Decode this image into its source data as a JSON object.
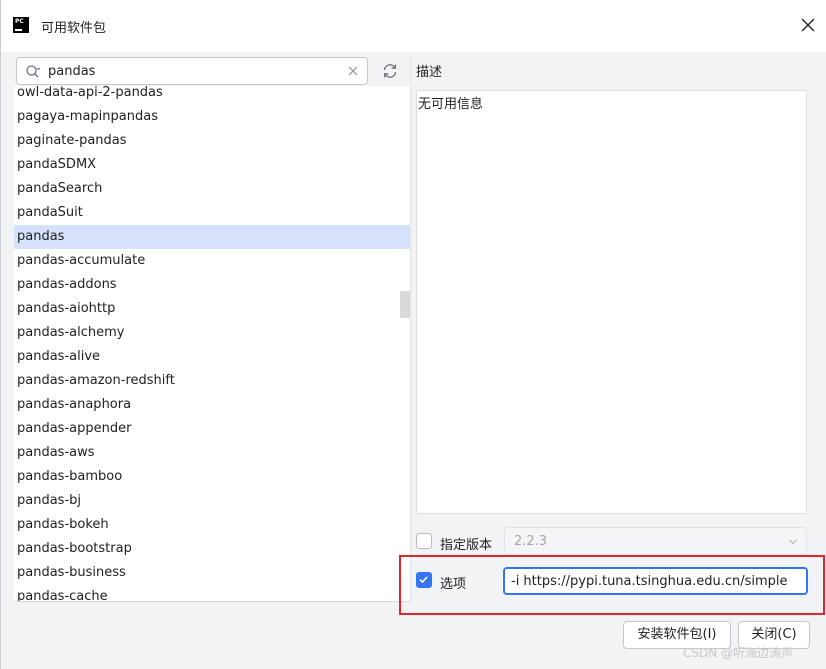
{
  "window": {
    "title": "可用软件包",
    "app_icon_text": "PC"
  },
  "search": {
    "value": "pandas"
  },
  "packages": [
    {
      "name": "owl-data-api-2-pandas",
      "selected": false
    },
    {
      "name": "pagaya-mapinpandas",
      "selected": false
    },
    {
      "name": "paginate-pandas",
      "selected": false
    },
    {
      "name": "pandaSDMX",
      "selected": false
    },
    {
      "name": "pandaSearch",
      "selected": false
    },
    {
      "name": "pandaSuit",
      "selected": false
    },
    {
      "name": "pandas",
      "selected": true
    },
    {
      "name": "pandas-accumulate",
      "selected": false
    },
    {
      "name": "pandas-addons",
      "selected": false
    },
    {
      "name": "pandas-aiohttp",
      "selected": false
    },
    {
      "name": "pandas-alchemy",
      "selected": false
    },
    {
      "name": "pandas-alive",
      "selected": false
    },
    {
      "name": "pandas-amazon-redshift",
      "selected": false
    },
    {
      "name": "pandas-anaphora",
      "selected": false
    },
    {
      "name": "pandas-appender",
      "selected": false
    },
    {
      "name": "pandas-aws",
      "selected": false
    },
    {
      "name": "pandas-bamboo",
      "selected": false
    },
    {
      "name": "pandas-bj",
      "selected": false
    },
    {
      "name": "pandas-bokeh",
      "selected": false
    },
    {
      "name": "pandas-bootstrap",
      "selected": false
    },
    {
      "name": "pandas-business",
      "selected": false
    },
    {
      "name": "pandas-cache",
      "selected": false
    }
  ],
  "description": {
    "label": "描述",
    "text": "无可用信息"
  },
  "version": {
    "checked": false,
    "label": "指定版本",
    "value": "2.2.3"
  },
  "options": {
    "checked": true,
    "label": "选项",
    "value": "-i https://pypi.tuna.tsinghua.edu.cn/simple"
  },
  "buttons": {
    "install": "安装软件包(I)",
    "close": "关闭(C)"
  },
  "watermark": "CSDN @听海边涛声",
  "colors": {
    "accent": "#3574f0",
    "selection": "#d6e2fb",
    "highlight_border": "#e0262a"
  }
}
